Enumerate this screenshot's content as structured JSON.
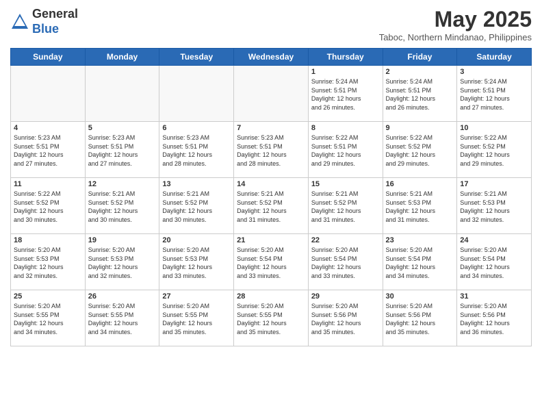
{
  "header": {
    "logo_line1": "General",
    "logo_line2": "Blue",
    "month_title": "May 2025",
    "location": "Taboc, Northern Mindanao, Philippines"
  },
  "weekdays": [
    "Sunday",
    "Monday",
    "Tuesday",
    "Wednesday",
    "Thursday",
    "Friday",
    "Saturday"
  ],
  "weeks": [
    [
      {
        "day": "",
        "info": ""
      },
      {
        "day": "",
        "info": ""
      },
      {
        "day": "",
        "info": ""
      },
      {
        "day": "",
        "info": ""
      },
      {
        "day": "1",
        "info": "Sunrise: 5:24 AM\nSunset: 5:51 PM\nDaylight: 12 hours\nand 26 minutes."
      },
      {
        "day": "2",
        "info": "Sunrise: 5:24 AM\nSunset: 5:51 PM\nDaylight: 12 hours\nand 26 minutes."
      },
      {
        "day": "3",
        "info": "Sunrise: 5:24 AM\nSunset: 5:51 PM\nDaylight: 12 hours\nand 27 minutes."
      }
    ],
    [
      {
        "day": "4",
        "info": "Sunrise: 5:23 AM\nSunset: 5:51 PM\nDaylight: 12 hours\nand 27 minutes."
      },
      {
        "day": "5",
        "info": "Sunrise: 5:23 AM\nSunset: 5:51 PM\nDaylight: 12 hours\nand 27 minutes."
      },
      {
        "day": "6",
        "info": "Sunrise: 5:23 AM\nSunset: 5:51 PM\nDaylight: 12 hours\nand 28 minutes."
      },
      {
        "day": "7",
        "info": "Sunrise: 5:23 AM\nSunset: 5:51 PM\nDaylight: 12 hours\nand 28 minutes."
      },
      {
        "day": "8",
        "info": "Sunrise: 5:22 AM\nSunset: 5:51 PM\nDaylight: 12 hours\nand 29 minutes."
      },
      {
        "day": "9",
        "info": "Sunrise: 5:22 AM\nSunset: 5:52 PM\nDaylight: 12 hours\nand 29 minutes."
      },
      {
        "day": "10",
        "info": "Sunrise: 5:22 AM\nSunset: 5:52 PM\nDaylight: 12 hours\nand 29 minutes."
      }
    ],
    [
      {
        "day": "11",
        "info": "Sunrise: 5:22 AM\nSunset: 5:52 PM\nDaylight: 12 hours\nand 30 minutes."
      },
      {
        "day": "12",
        "info": "Sunrise: 5:21 AM\nSunset: 5:52 PM\nDaylight: 12 hours\nand 30 minutes."
      },
      {
        "day": "13",
        "info": "Sunrise: 5:21 AM\nSunset: 5:52 PM\nDaylight: 12 hours\nand 30 minutes."
      },
      {
        "day": "14",
        "info": "Sunrise: 5:21 AM\nSunset: 5:52 PM\nDaylight: 12 hours\nand 31 minutes."
      },
      {
        "day": "15",
        "info": "Sunrise: 5:21 AM\nSunset: 5:52 PM\nDaylight: 12 hours\nand 31 minutes."
      },
      {
        "day": "16",
        "info": "Sunrise: 5:21 AM\nSunset: 5:53 PM\nDaylight: 12 hours\nand 31 minutes."
      },
      {
        "day": "17",
        "info": "Sunrise: 5:21 AM\nSunset: 5:53 PM\nDaylight: 12 hours\nand 32 minutes."
      }
    ],
    [
      {
        "day": "18",
        "info": "Sunrise: 5:20 AM\nSunset: 5:53 PM\nDaylight: 12 hours\nand 32 minutes."
      },
      {
        "day": "19",
        "info": "Sunrise: 5:20 AM\nSunset: 5:53 PM\nDaylight: 12 hours\nand 32 minutes."
      },
      {
        "day": "20",
        "info": "Sunrise: 5:20 AM\nSunset: 5:53 PM\nDaylight: 12 hours\nand 33 minutes."
      },
      {
        "day": "21",
        "info": "Sunrise: 5:20 AM\nSunset: 5:54 PM\nDaylight: 12 hours\nand 33 minutes."
      },
      {
        "day": "22",
        "info": "Sunrise: 5:20 AM\nSunset: 5:54 PM\nDaylight: 12 hours\nand 33 minutes."
      },
      {
        "day": "23",
        "info": "Sunrise: 5:20 AM\nSunset: 5:54 PM\nDaylight: 12 hours\nand 34 minutes."
      },
      {
        "day": "24",
        "info": "Sunrise: 5:20 AM\nSunset: 5:54 PM\nDaylight: 12 hours\nand 34 minutes."
      }
    ],
    [
      {
        "day": "25",
        "info": "Sunrise: 5:20 AM\nSunset: 5:55 PM\nDaylight: 12 hours\nand 34 minutes."
      },
      {
        "day": "26",
        "info": "Sunrise: 5:20 AM\nSunset: 5:55 PM\nDaylight: 12 hours\nand 34 minutes."
      },
      {
        "day": "27",
        "info": "Sunrise: 5:20 AM\nSunset: 5:55 PM\nDaylight: 12 hours\nand 35 minutes."
      },
      {
        "day": "28",
        "info": "Sunrise: 5:20 AM\nSunset: 5:55 PM\nDaylight: 12 hours\nand 35 minutes."
      },
      {
        "day": "29",
        "info": "Sunrise: 5:20 AM\nSunset: 5:56 PM\nDaylight: 12 hours\nand 35 minutes."
      },
      {
        "day": "30",
        "info": "Sunrise: 5:20 AM\nSunset: 5:56 PM\nDaylight: 12 hours\nand 35 minutes."
      },
      {
        "day": "31",
        "info": "Sunrise: 5:20 AM\nSunset: 5:56 PM\nDaylight: 12 hours\nand 36 minutes."
      }
    ]
  ]
}
